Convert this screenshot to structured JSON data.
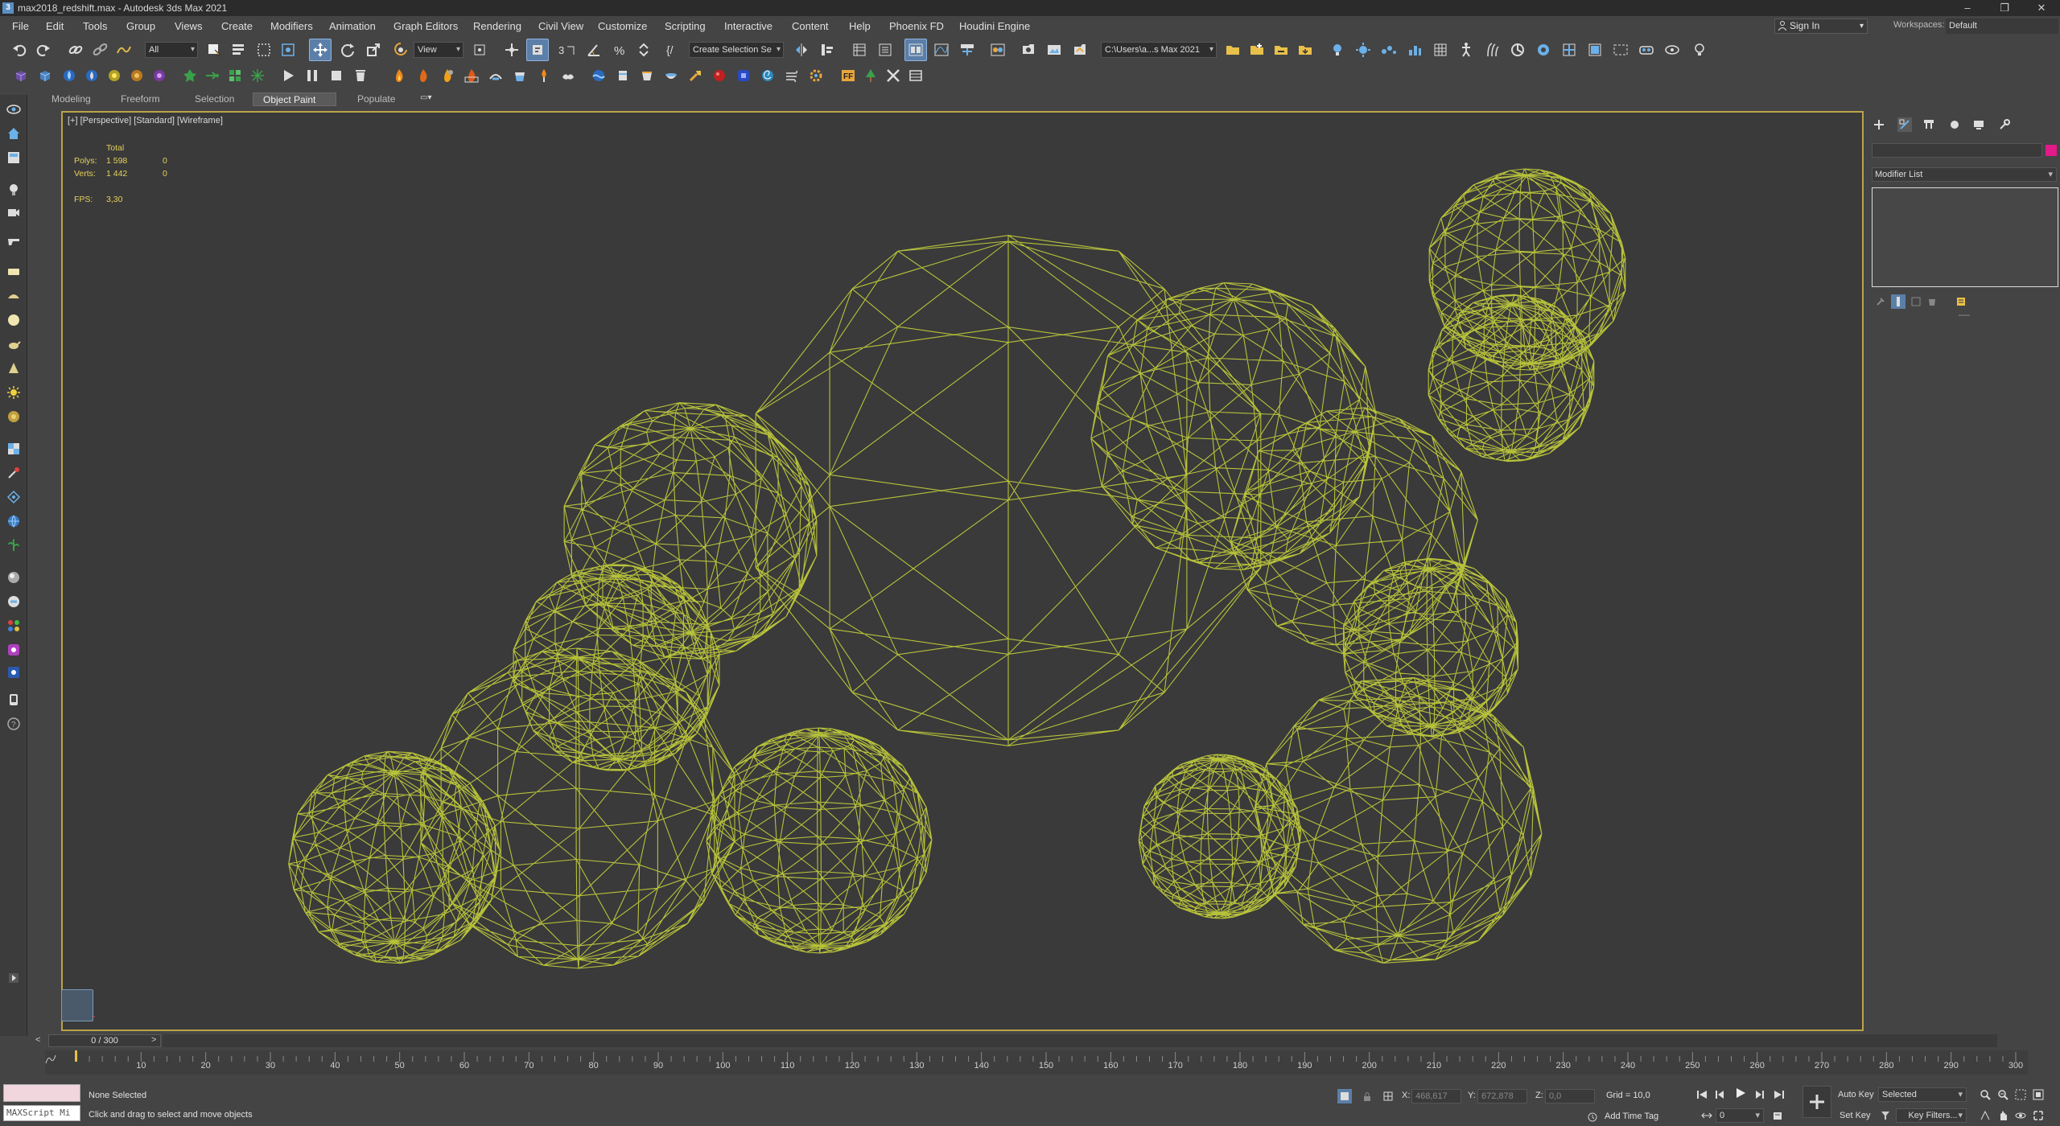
{
  "window": {
    "title": "max2018_redshift.max - Autodesk 3ds Max 2021",
    "app_icon": "3",
    "controls": [
      "minimize-icon",
      "restore-icon",
      "close-icon"
    ]
  },
  "menu": [
    "File",
    "Edit",
    "Tools",
    "Group",
    "Views",
    "Create",
    "Modifiers",
    "Animation",
    "Graph Editors",
    "Rendering",
    "Civil View",
    "Customize",
    "Scripting",
    "Interactive",
    "Content",
    "Help",
    "Phoenix FD",
    "Houdini Engine"
  ],
  "account": {
    "sign_in": "Sign In",
    "workspaces_label": "Workspaces:",
    "workspace_value": "Default"
  },
  "toolbar": {
    "selection_filter": "All",
    "reference_coord": "View",
    "named_selection": "Create Selection Se",
    "project_path": "C:\\Users\\a...s Max 2021"
  },
  "ribbon": {
    "tabs": [
      "Modeling",
      "Freeform",
      "Selection",
      "Object Paint",
      "Populate"
    ],
    "active": "Object Paint"
  },
  "viewport": {
    "label": "[+] [Perspective] [Standard] [Wireframe]",
    "stats": {
      "header": "Total",
      "polys_label": "Polys:",
      "polys_total": "1 598",
      "polys_sel": "0",
      "verts_label": "Verts:",
      "verts_total": "1 442",
      "verts_sel": "0",
      "fps_label": "FPS:",
      "fps_value": "3,30"
    },
    "wire_color": "#b7c23a",
    "border_color": "#b9a34a"
  },
  "command_panel": {
    "modifier_list": "Modifier List",
    "object_color": "#e21a8a"
  },
  "time": {
    "slider_label": "0 / 300",
    "ticks": [
      10,
      20,
      30,
      40,
      50,
      60,
      70,
      80,
      90,
      100,
      110,
      120,
      130,
      140,
      150,
      160,
      170,
      180,
      190,
      200,
      210,
      220,
      230,
      240,
      250,
      260,
      270,
      280,
      290,
      300
    ]
  },
  "status": {
    "maxscript": "MAXScript Mi",
    "selection": "None Selected",
    "prompt": "Click and drag to select and move objects",
    "x_label": "X:",
    "x_value": "468,617",
    "y_label": "Y:",
    "y_value": "672,878",
    "z_label": "Z:",
    "z_value": "0,0",
    "grid": "Grid = 10,0",
    "add_time_tag": "Add Time Tag",
    "auto_key": "Auto Key",
    "key_mode": "Selected",
    "set_key": "Set Key",
    "key_filters": "Key Filters...",
    "frame": "0"
  }
}
